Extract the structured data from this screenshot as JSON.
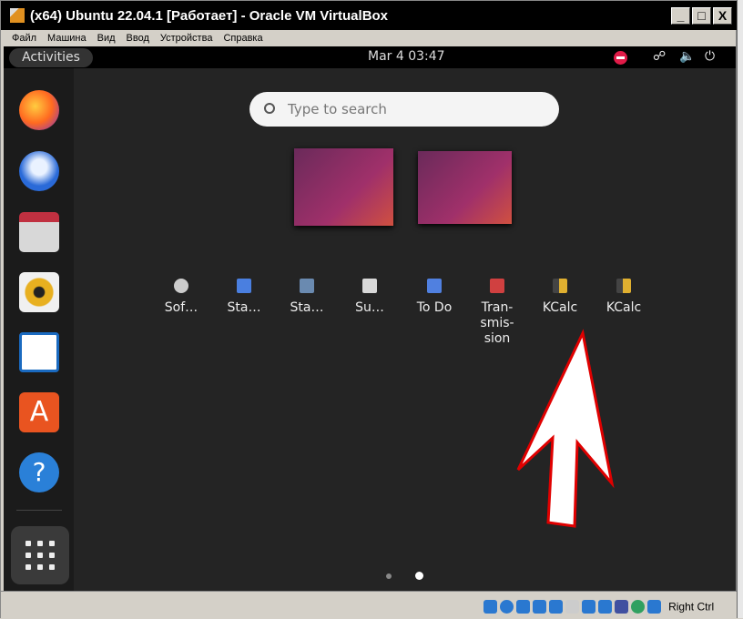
{
  "window": {
    "title": "(x64) Ubuntu 22.04.1 [Работает] - Oracle VM VirtualBox",
    "buttons": [
      "_",
      "□",
      "X"
    ]
  },
  "menu": [
    "Файл",
    "Машина",
    "Вид",
    "Ввод",
    "Устройства",
    "Справка"
  ],
  "panel": {
    "activities": "Activities",
    "clock": "Mar 4  03:47"
  },
  "search": {
    "placeholder": "Type to search"
  },
  "dock": [
    "firefox",
    "thunderbird",
    "files",
    "rhythmbox",
    "libreoffice-writer",
    "software",
    "help",
    "show-apps"
  ],
  "apps": [
    {
      "label": "Sof…",
      "icon": "software-icon",
      "color": "#cccccc"
    },
    {
      "label": "Sta…",
      "icon": "startup-disk-icon",
      "color": "#4a7fe0"
    },
    {
      "label": "Sta…",
      "icon": "startup-apps-icon",
      "color": "#6a8ab0"
    },
    {
      "label": "Su…",
      "icon": "sudoku-icon",
      "color": "#d8d8d8"
    },
    {
      "label": "To Do",
      "icon": "todo-icon",
      "color": "#5080e0"
    },
    {
      "label": "Tran-\nsmis-\nsion",
      "icon": "transmission-icon",
      "color": "#d04040"
    },
    {
      "label": "KCalc",
      "icon": "kcalc-icon",
      "color": "#e0b030"
    },
    {
      "label": "KCalc",
      "icon": "kcalc-icon",
      "color": "#e0b030"
    }
  ],
  "status": {
    "host_key": "Right Ctrl"
  }
}
